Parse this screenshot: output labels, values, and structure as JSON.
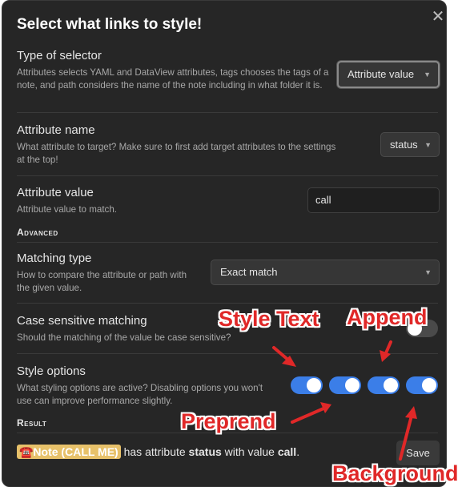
{
  "modal": {
    "title": "Select what links to style!",
    "close_icon": "✕"
  },
  "settings": {
    "selector_type": {
      "name": "Type of selector",
      "desc": "Attributes selects YAML and DataView attributes, tags chooses the tags of a note, and path considers the name of the note including in what folder it is.",
      "value": "Attribute value"
    },
    "attribute_name": {
      "name": "Attribute name",
      "desc": "What attribute to target? Make sure to first add target attributes to the settings at the top!",
      "value": "status"
    },
    "attribute_value": {
      "name": "Attribute value",
      "desc": "Attribute value to match.",
      "value": "call"
    },
    "advanced_heading": "Advanced",
    "matching_type": {
      "name": "Matching type",
      "desc": "How to compare the attribute or path with the given value.",
      "value": "Exact match"
    },
    "case_sensitive": {
      "name": "Case sensitive matching",
      "desc": "Should the matching of the value be case sensitive?",
      "enabled": false
    },
    "style_options": {
      "name": "Style options",
      "desc": "What styling options are active? Disabling options you won't use can improve performance slightly.",
      "toggles": [
        true,
        true,
        true,
        true
      ]
    }
  },
  "result": {
    "heading": "Result",
    "note_label": "☎️Note (CALL ME)",
    "text_1": " has attribute ",
    "attr": "status",
    "text_2": " with value ",
    "value": "call",
    "text_3": ".",
    "save_label": "Save"
  },
  "annotations": {
    "style_text": "Style Text",
    "append": "Append",
    "prepend": "Preprend",
    "background": "Background",
    "color": "#e02828"
  },
  "icons": {
    "chevron": "chevron-down-icon",
    "close": "close-icon"
  }
}
